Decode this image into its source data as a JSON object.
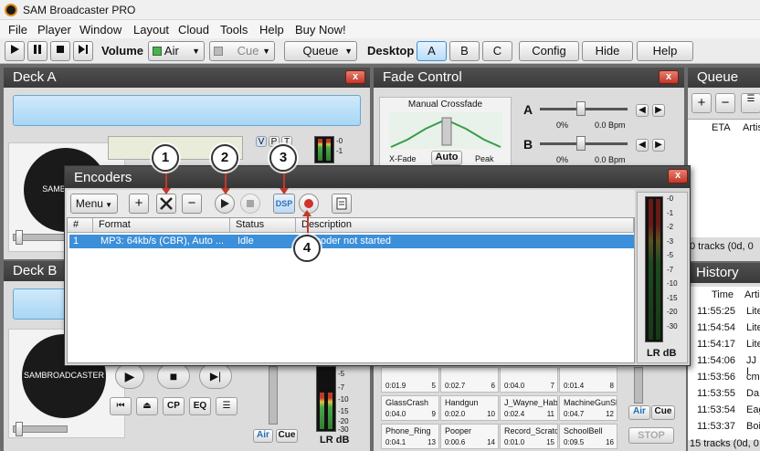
{
  "window": {
    "title": "SAM Broadcaster PRO"
  },
  "menu": [
    "File",
    "Player",
    "Window",
    "Layout",
    "Cloud",
    "Tools",
    "Help",
    "Buy Now!"
  ],
  "toolbar": {
    "volume_label": "Volume",
    "air_label": "Air",
    "cue_label": "Cue",
    "queue_label": "Queue",
    "desktop_label": "Desktop",
    "desktop_a": "A",
    "desktop_b": "B",
    "desktop_c": "C",
    "config_label": "Config",
    "hide_label": "Hide",
    "help_label": "Help"
  },
  "deck_a": {
    "title": "Deck A",
    "close": "x",
    "vpt": [
      "V",
      "P",
      "T"
    ],
    "meter_scale": [
      "-0",
      "-1"
    ],
    "disc_text": "SAMBROAD"
  },
  "deck_b": {
    "title": "Deck B",
    "close": "x",
    "disc_text": "SAMBROADCASTER",
    "eq_label": "EQ",
    "cp_label": "CP",
    "meter_scale": [
      "-5",
      "-7",
      "-10",
      "-15",
      "-20",
      "-30"
    ],
    "lr_db": "LR dB",
    "air_label": "Air",
    "cue_label": "Cue"
  },
  "fade": {
    "title": "Fade Control",
    "close": "x",
    "manual_crossfade": "Manual Crossfade",
    "a_label": "A",
    "b_label": "B",
    "a_pct": "0%",
    "a_bpm": "0.0 Bpm",
    "b_pct": "0%",
    "b_bpm": "0.0 Bpm",
    "xfade": "X-Fade",
    "auto": "Auto",
    "peak": "Peak"
  },
  "queue": {
    "title": "Queue",
    "eta": "ETA",
    "artist": "Artis",
    "tracks": "0 tracks (0d, 0"
  },
  "history": {
    "title": "History",
    "time_header": "Time",
    "artist_header": "Artis",
    "rows": [
      {
        "time": "11:55:25",
        "artist": "Lite"
      },
      {
        "time": "11:54:54",
        "artist": "Lite"
      },
      {
        "time": "11:54:17",
        "artist": "Lite"
      },
      {
        "time": "11:54:06",
        "artist": "JJ I"
      },
      {
        "time": "11:53:56",
        "artist": "cm"
      },
      {
        "time": "11:53:55",
        "artist": "Da"
      },
      {
        "time": "11:53:54",
        "artist": "Eag"
      },
      {
        "time": "11:53:37",
        "artist": "Boi"
      }
    ],
    "tracks": "15 tracks (0d, 0",
    "air_label": "Air",
    "cue_label": "Cue",
    "stop_label": "STOP"
  },
  "sound_fx": {
    "cells": [
      {
        "name": "",
        "time": "0:01.9",
        "num": "5"
      },
      {
        "name": "",
        "time": "0:02.7",
        "num": "6"
      },
      {
        "name": "",
        "time": "0:04.0",
        "num": "7"
      },
      {
        "name": "",
        "time": "0:01.4",
        "num": "8"
      },
      {
        "name": "GlassCrash",
        "time": "0:04.0",
        "num": "9"
      },
      {
        "name": "Handgun",
        "time": "0:02.0",
        "num": "10"
      },
      {
        "name": "J_Wayne_Habit",
        "time": "0:02.4",
        "num": "11"
      },
      {
        "name": "MachineGunShe",
        "time": "0:04.7",
        "num": "12"
      },
      {
        "name": "Phone_Ring",
        "time": "0:04.1",
        "num": "13"
      },
      {
        "name": "Pooper",
        "time": "0:00.6",
        "num": "14"
      },
      {
        "name": "Record_Scratch",
        "time": "0:01.0",
        "num": "15"
      },
      {
        "name": "SchoolBell",
        "time": "0:09.5",
        "num": "16"
      }
    ]
  },
  "encoders": {
    "title": "Encoders",
    "close": "x",
    "menu_label": "Menu",
    "dsp_label": "DSP",
    "columns": [
      "#",
      "Format",
      "Status",
      "Description"
    ],
    "rows": [
      {
        "num": "1",
        "format": "MP3: 64kb/s (CBR), Auto ...",
        "status": "Idle",
        "description": "Encoder not started"
      }
    ],
    "meter_scale": [
      "-0",
      "-1",
      "-2",
      "-3",
      "-5",
      "-7",
      "-10",
      "-15",
      "-20",
      "-30"
    ],
    "lr_db": "LR dB"
  },
  "callouts": [
    "1",
    "2",
    "3",
    "4"
  ]
}
